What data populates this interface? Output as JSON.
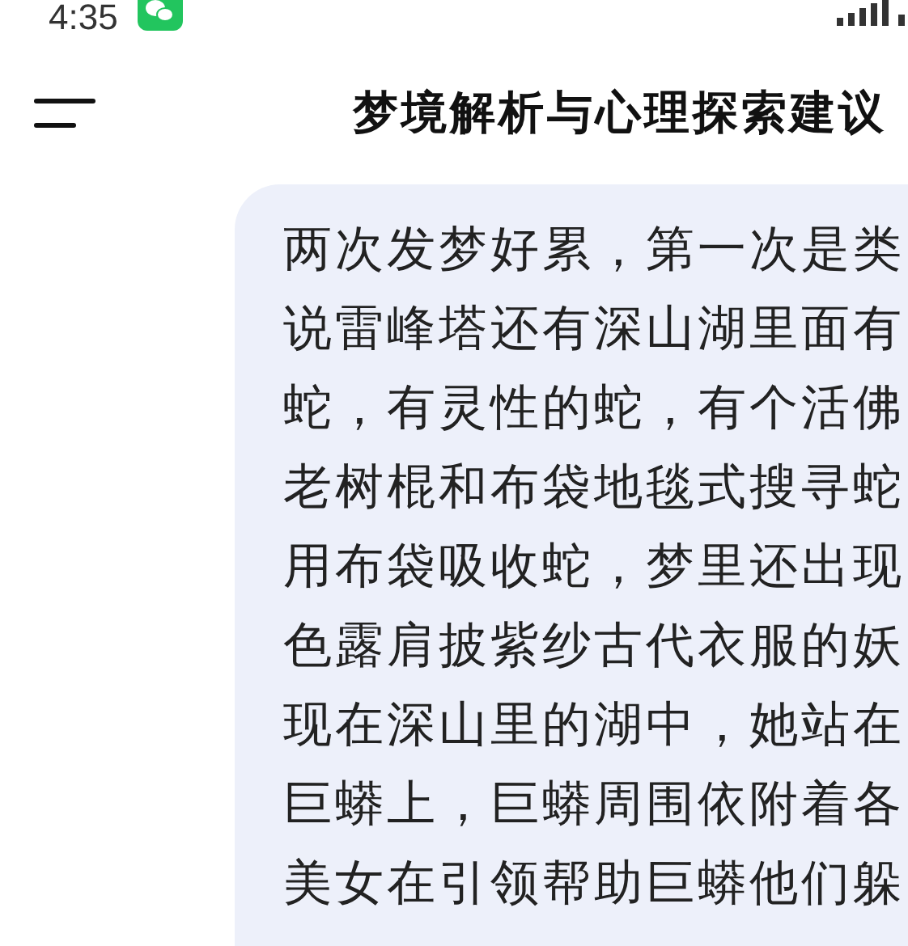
{
  "status_bar": {
    "time": "4:35"
  },
  "header": {
    "title": "梦境解析与心理探索建议"
  },
  "message": {
    "text": "两次发梦好累，第一次是类说雷峰塔还有深山湖里面有蛇，有灵性的蛇，有个活佛老树棍和布袋地毯式搜寻蛇用布袋吸收蛇，梦里还出现色露肩披紫纱古代衣服的妖现在深山里的湖中，她站在巨蟒上，巨蟒周围依附着各美女在引领帮助巨蟒他们躲"
  }
}
